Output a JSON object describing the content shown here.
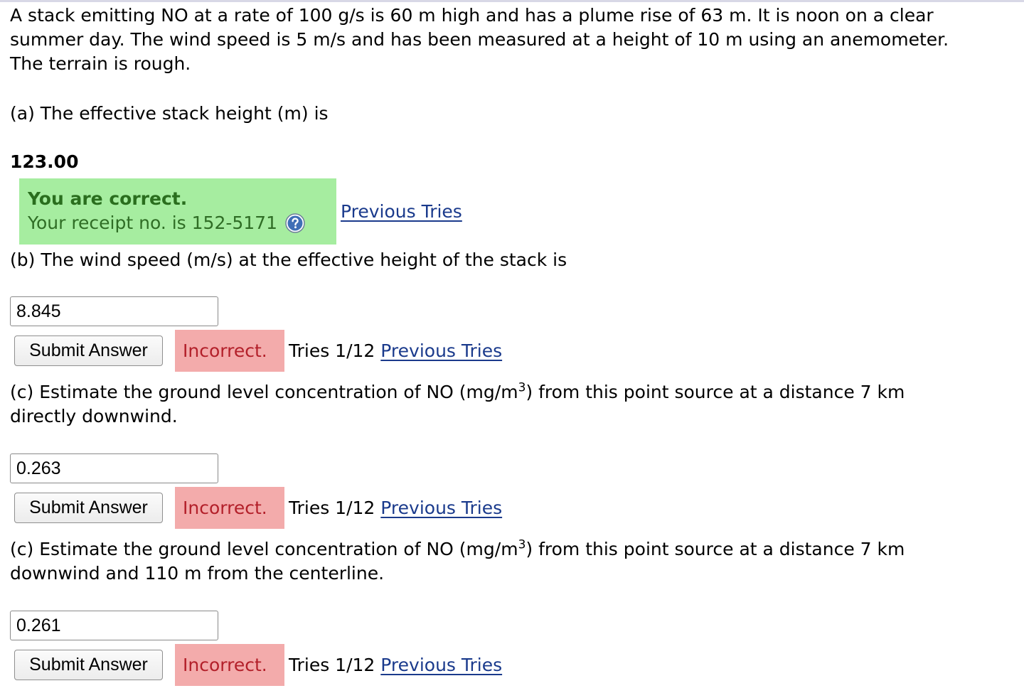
{
  "problem": {
    "line1": "A stack emitting NO at a rate of 100 g/s is 60 m high and has a plume rise of 63 m. It is noon on a clear",
    "line2": "summer day. The wind speed is 5 m/s and has been measured at a height of 10 m using an anemometer.",
    "line3": "The terrain is rough."
  },
  "part_a": {
    "question": "(a) The effective stack height (m) is",
    "answer": "123.00",
    "correct_title": "You are correct.",
    "receipt_text": "Your receipt no. is 152-5171",
    "help_icon": "question-circle-icon",
    "previous_tries_link": "Previous Tries"
  },
  "part_b": {
    "question": "(b) The wind speed (m/s) at the effective height of the stack is",
    "input_value": "8.845",
    "submit_label": "Submit Answer",
    "status": "Incorrect.",
    "tries": "Tries 1/12",
    "previous_tries_link": "Previous Tries"
  },
  "part_c1": {
    "question_line1_pre": "(c) Estimate the ground level concentration of NO (mg/m",
    "question_sup": "3",
    "question_line1_post": ") from this point source at a distance 7 km",
    "question_line2": "directly downwind.",
    "input_value": "0.263",
    "submit_label": "Submit Answer",
    "status": "Incorrect.",
    "tries": "Tries 1/12",
    "previous_tries_link": "Previous Tries"
  },
  "part_c2": {
    "question_line1_pre": "(c) Estimate the ground level concentration of NO (mg/m",
    "question_sup": "3",
    "question_line1_post": ") from this point source at a distance 7 km",
    "question_line2": "downwind and 110 m from the centerline.",
    "input_value": "0.261",
    "submit_label": "Submit Answer",
    "status": "Incorrect.",
    "tries": "Tries 1/12",
    "previous_tries_link": "Previous Tries"
  },
  "colors": {
    "correct_bg": "#a6eda0",
    "correct_text": "#2a6e1e",
    "incorrect_bg": "#f3abab",
    "incorrect_text": "#b3202a",
    "link": "#1a3a8c"
  }
}
